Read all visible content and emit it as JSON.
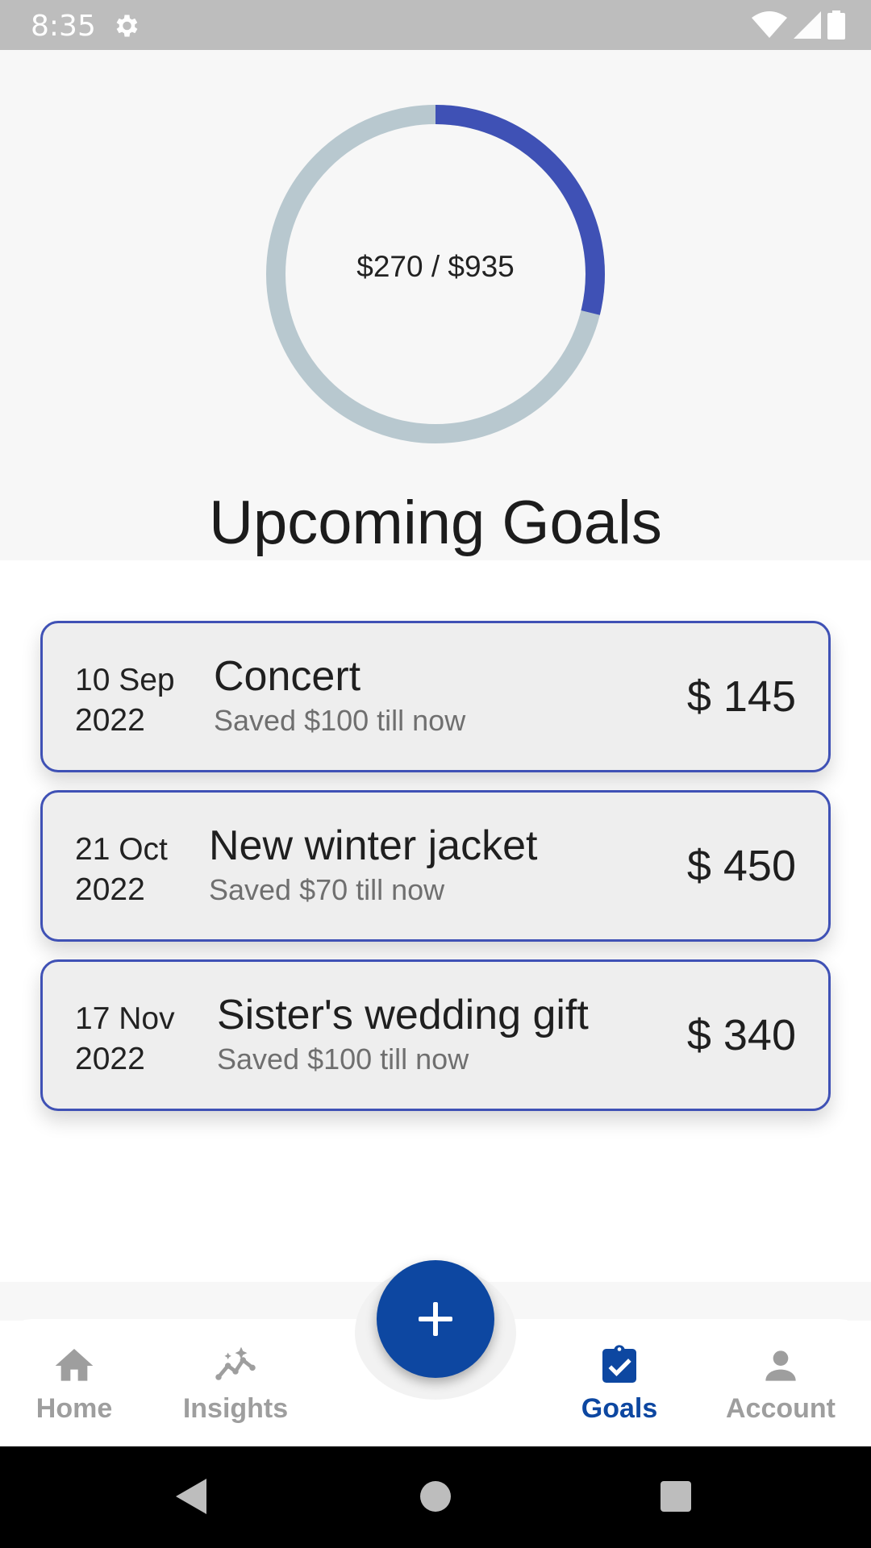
{
  "status_bar": {
    "time": "8:35"
  },
  "summary": {
    "progress_text": "$270 / $935",
    "saved": 270,
    "target": 935,
    "ring_color": "#3f51b5",
    "track_color": "#b8c8cf"
  },
  "section_title": "Upcoming Goals",
  "goals": [
    {
      "day_month": "10 Sep",
      "year": "2022",
      "name": "Concert",
      "saved": "Saved $100 till now",
      "amount": "$ 145"
    },
    {
      "day_month": "21 Oct",
      "year": "2022",
      "name": "New winter jacket",
      "saved": "Saved $70 till now",
      "amount": "$ 450"
    },
    {
      "day_month": "17 Nov",
      "year": "2022",
      "name": "Sister's wedding gift",
      "saved": "Saved $100 till now",
      "amount": "$ 340"
    }
  ],
  "bottom_nav": {
    "items": [
      {
        "label": "Home",
        "icon": "home-icon"
      },
      {
        "label": "Insights",
        "icon": "insights-icon"
      },
      {
        "label": "Goals",
        "icon": "goals-icon",
        "active": true
      },
      {
        "label": "Account",
        "icon": "account-icon"
      }
    ],
    "fab_icon": "plus-icon",
    "active_color": "#0d47a1"
  }
}
